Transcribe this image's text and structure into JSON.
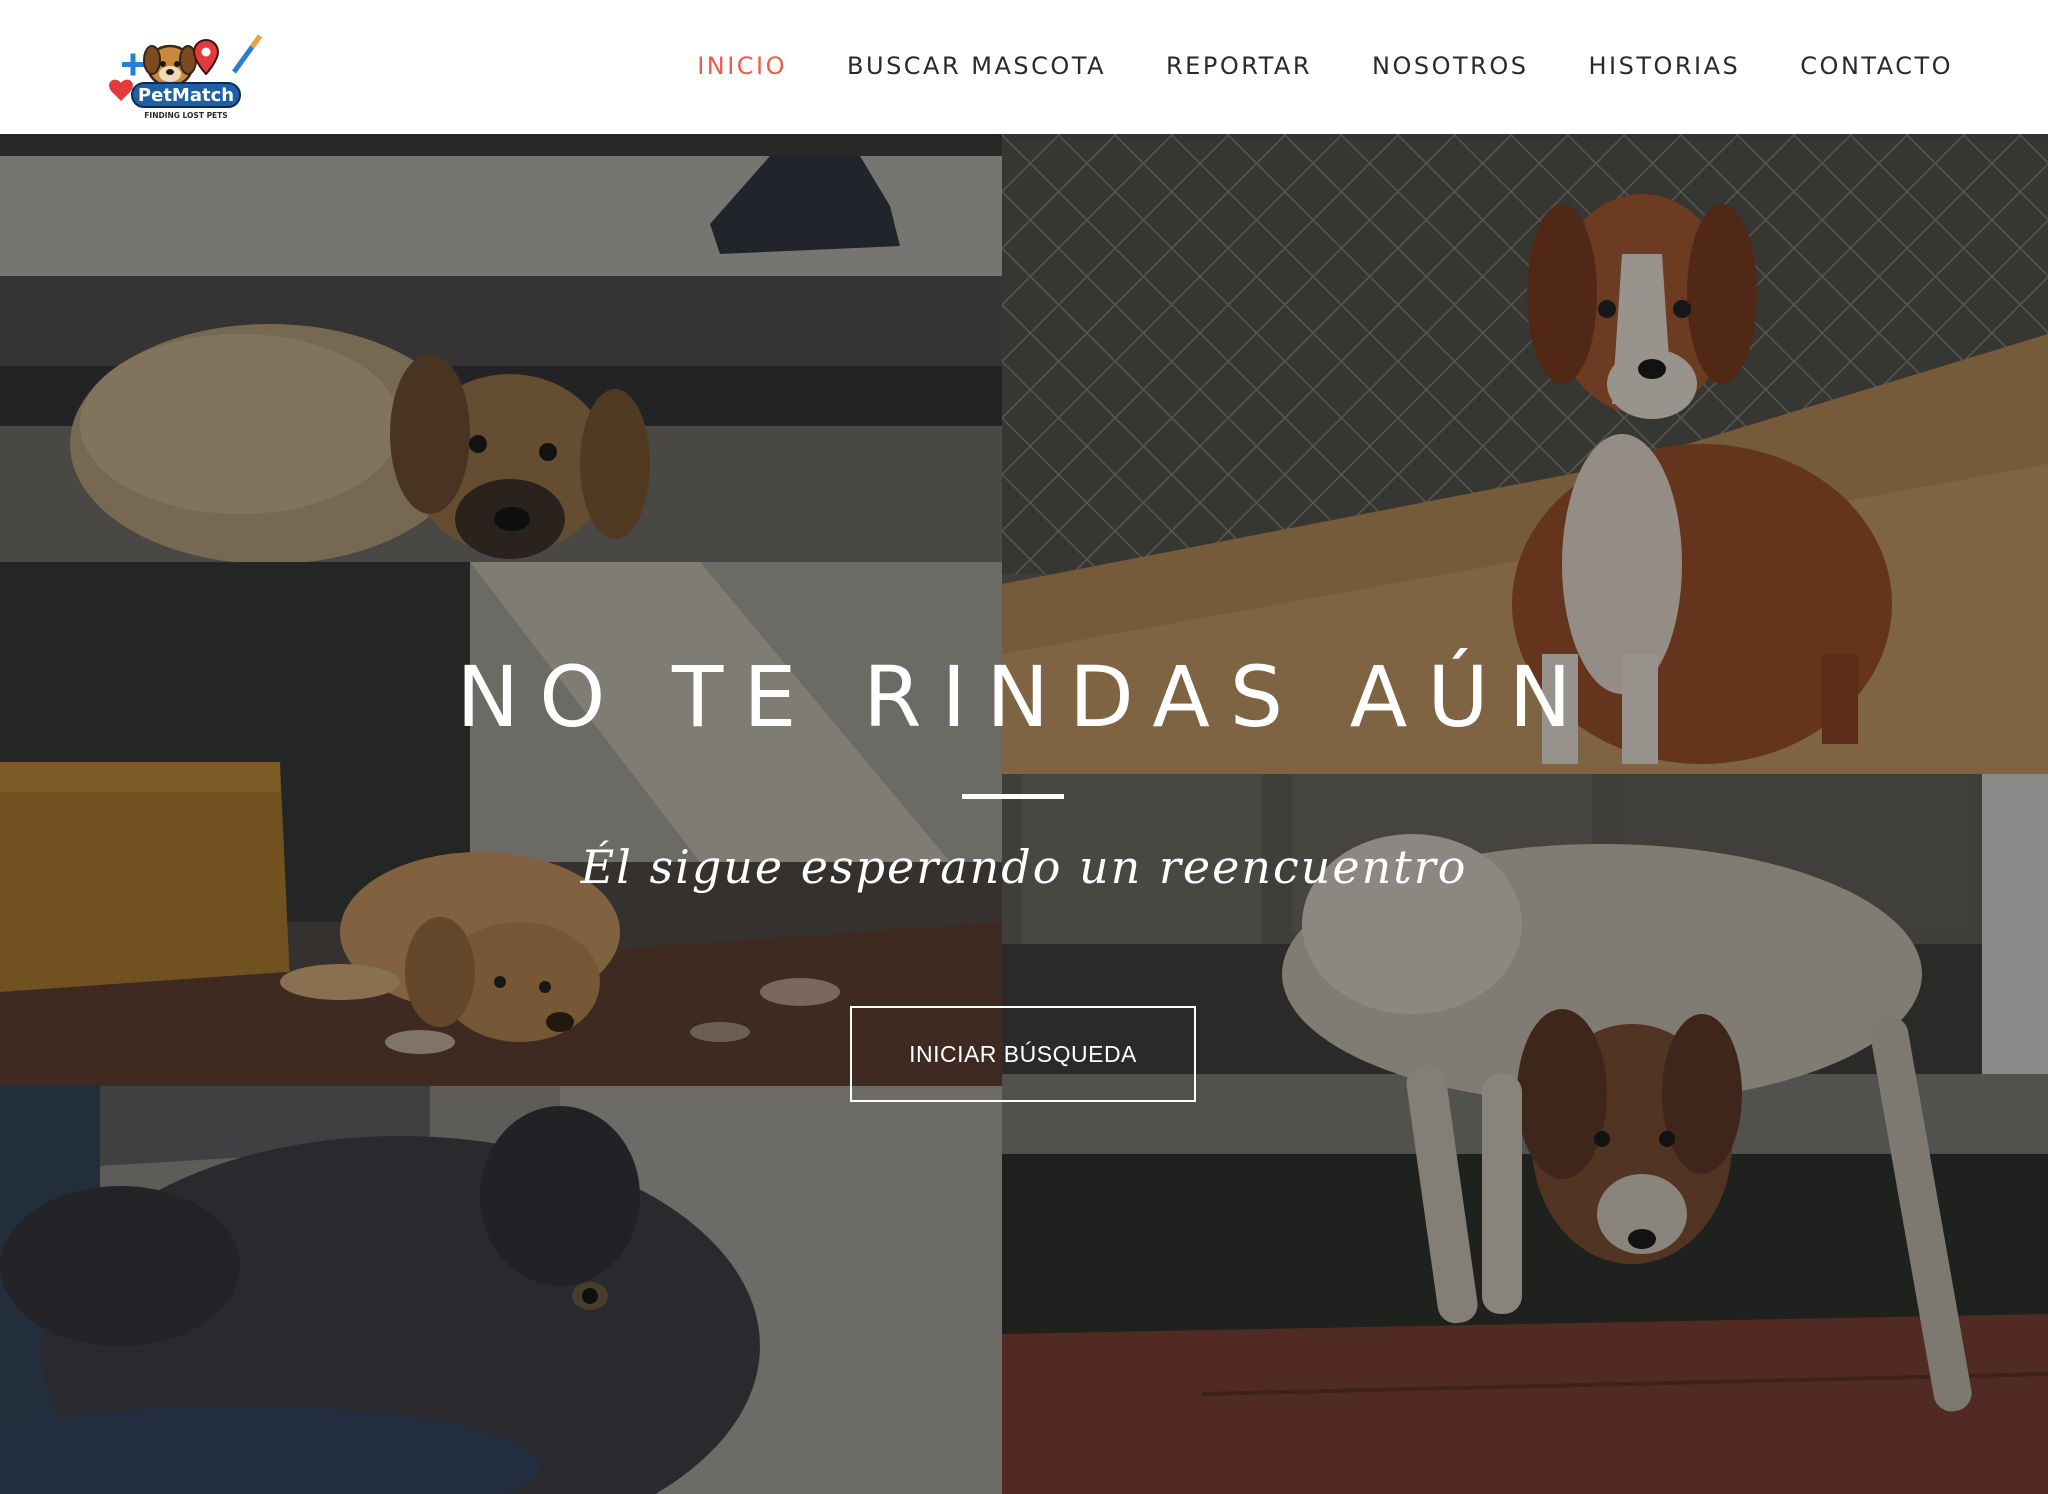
{
  "brand": {
    "name": "PetMatch",
    "tagline": "FINDING LOST PETS"
  },
  "nav": {
    "items": [
      {
        "label": "INICIO",
        "active": true
      },
      {
        "label": "BUSCAR MASCOTA",
        "active": false
      },
      {
        "label": "REPORTAR",
        "active": false
      },
      {
        "label": "NOSOTROS",
        "active": false
      },
      {
        "label": "HISTORIAS",
        "active": false
      },
      {
        "label": "CONTACTO",
        "active": false
      }
    ],
    "active_color": "#ef5b47"
  },
  "hero": {
    "title": "NO TE RINDAS AÚN",
    "subtitle": "Él sigue esperando un reencuentro",
    "cta_label": "INICIAR BÚSQUEDA",
    "photos": [
      "puppy-curled-on-step",
      "brown-white-puppy-sitting-by-fence",
      "tan-puppy-lying-on-dirt",
      "white-brown-dog-lying-on-doorstep",
      "dark-puppy-closeup"
    ]
  }
}
